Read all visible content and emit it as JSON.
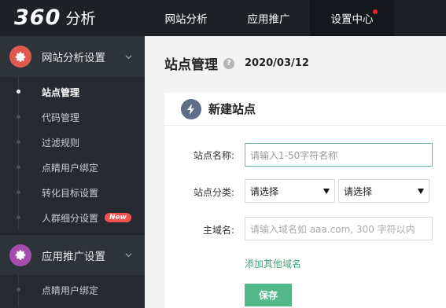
{
  "header": {
    "logo_number": "360",
    "logo_text": "分析",
    "nav": [
      {
        "label": "网站分析"
      },
      {
        "label": "应用推广"
      },
      {
        "label": "设置中心"
      }
    ]
  },
  "sidebar": {
    "group1": {
      "title": "网站分析设置",
      "icon": "gear-icon",
      "icon_color": "#e0594f",
      "items": [
        {
          "label": "站点管理"
        },
        {
          "label": "代码管理"
        },
        {
          "label": "过滤规则"
        },
        {
          "label": "点睛用户绑定"
        },
        {
          "label": "转化目标设置"
        },
        {
          "label": "人群细分设置",
          "badge": "New"
        }
      ]
    },
    "group2": {
      "title": "应用推广设置",
      "icon": "gear-icon",
      "icon_color": "#a64cad",
      "items": [
        {
          "label": "点睛用户绑定"
        }
      ]
    }
  },
  "page": {
    "title": "站点管理",
    "help": "?",
    "date": "2020/03/12"
  },
  "card": {
    "title": "新建站点",
    "icon": "lightning-icon",
    "site_name_label": "站点名称:",
    "site_name_placeholder": "请输入1-50字符名称",
    "category_label": "站点分类:",
    "category_select1": "请选择",
    "category_select2": "请选择",
    "domain_label": "主域名:",
    "domain_placeholder": "请输入域名如 aaa.com, 300 字符以内",
    "add_domain_link": "添加其他域名",
    "save_button": "保存"
  },
  "colors": {
    "accent_green": "#53b888",
    "topbar": "#1e2227",
    "sidebar": "#262a30",
    "notification_dot": "#f0232d"
  }
}
